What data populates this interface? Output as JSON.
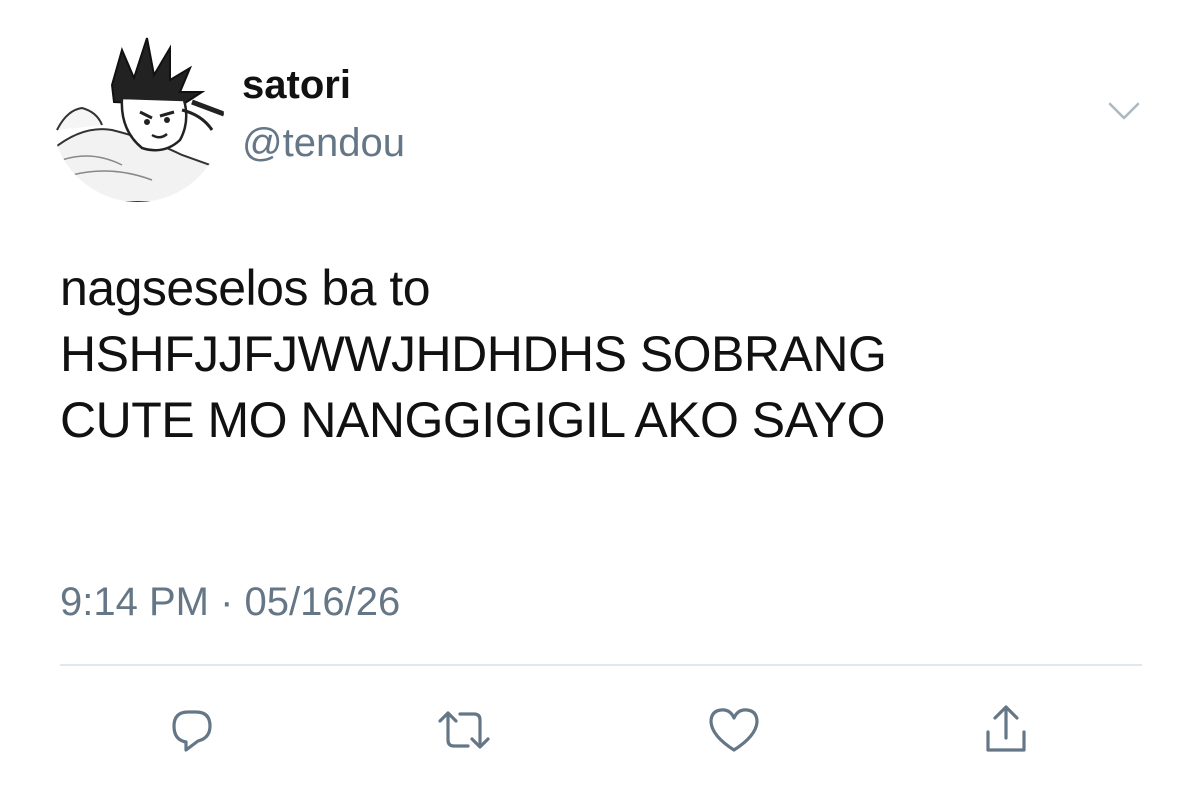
{
  "tweet": {
    "display_name": "satori",
    "handle": "@tendou",
    "text_lines": [
      "nagseselos ba to",
      "HSHFJJFJWWJHDHDHS SOBRANG",
      "CUTE MO NANGGIGIGIL AKO SAYO"
    ],
    "time": "9:14 PM",
    "separator": "·",
    "date": "05/16/26"
  },
  "icons": {
    "menu": "chevron-down-icon",
    "reply": "reply-icon",
    "retweet": "retweet-icon",
    "like": "heart-icon",
    "share": "share-icon"
  },
  "colors": {
    "text": "#111111",
    "secondary": "#657786",
    "icon": "#657786",
    "caret": "#aab8c2",
    "divider": "#e1e8ed"
  }
}
